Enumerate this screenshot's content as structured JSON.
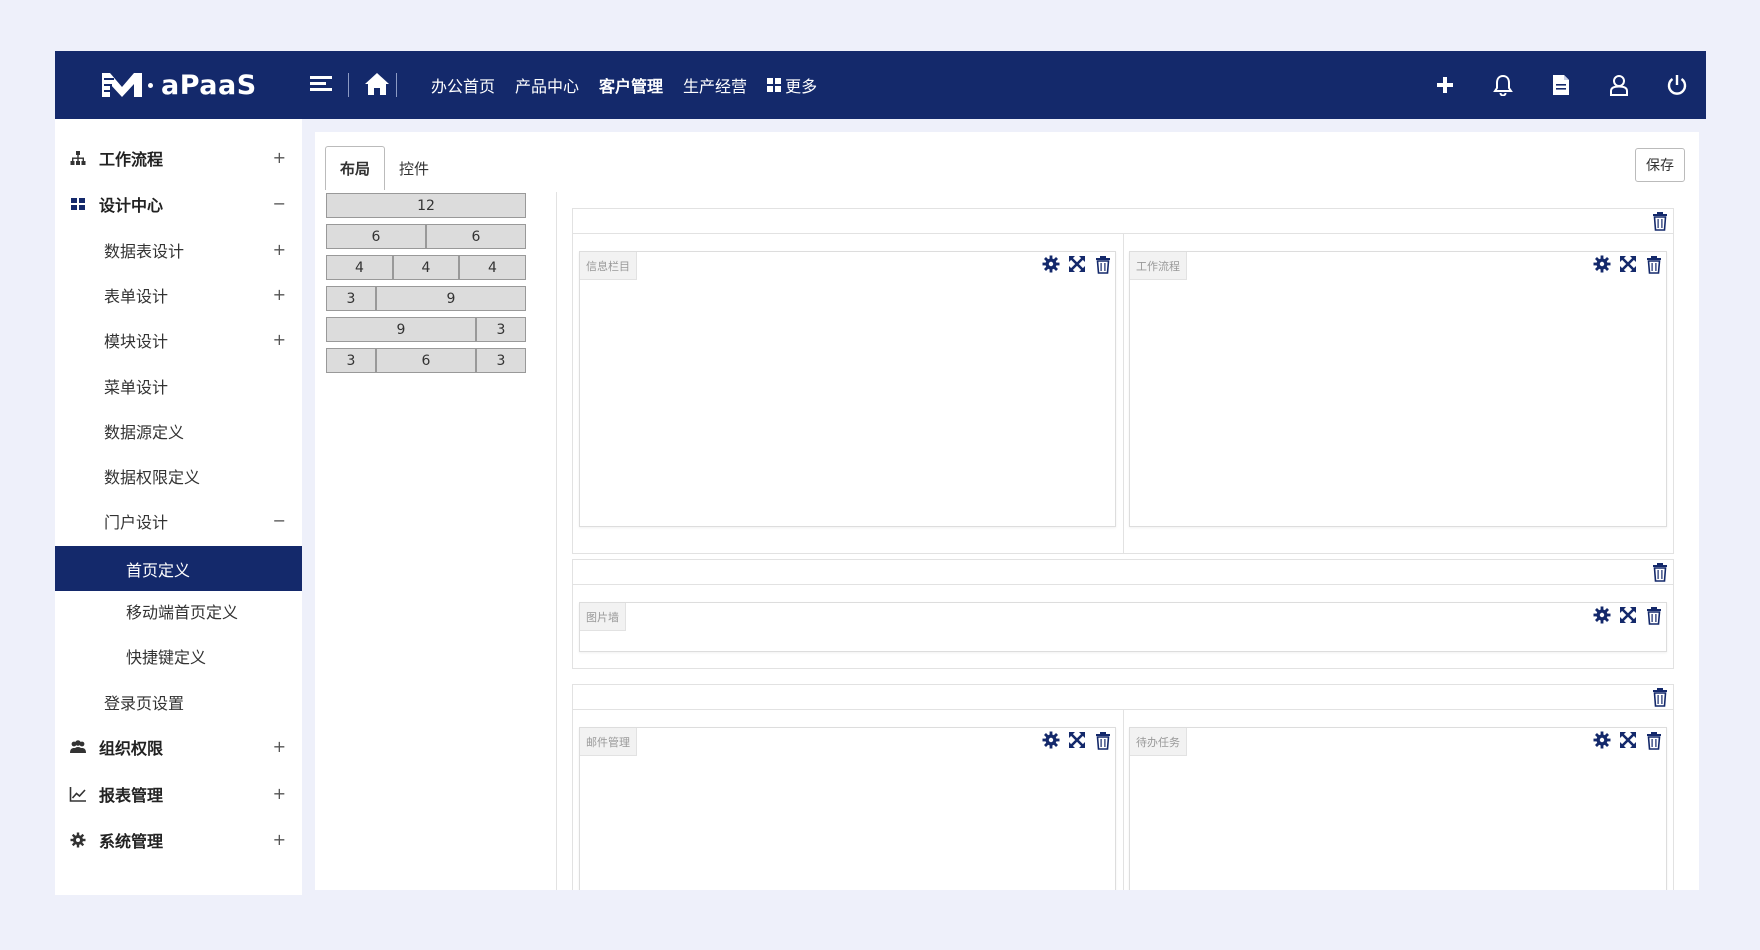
{
  "app": {
    "logo_text": "aPaaS"
  },
  "topnav": {
    "items": [
      "办公首页",
      "产品中心",
      "客户管理",
      "生产经营"
    ],
    "active_index": 2,
    "more_label": "更多"
  },
  "sidebar": {
    "items": [
      {
        "label": "工作流程",
        "toggle": "+",
        "icon": "sitemap-icon"
      },
      {
        "label": "设计中心",
        "toggle": "−",
        "icon": "grid-icon"
      },
      {
        "label": "数据表设计",
        "toggle": "+"
      },
      {
        "label": "表单设计",
        "toggle": "+"
      },
      {
        "label": "模块设计",
        "toggle": "+"
      },
      {
        "label": "菜单设计"
      },
      {
        "label": "数据源定义"
      },
      {
        "label": "数据权限定义"
      },
      {
        "label": "门户设计",
        "toggle": "−"
      },
      {
        "label": "首页定义"
      },
      {
        "label": "移动端首页定义"
      },
      {
        "label": "快捷键定义"
      },
      {
        "label": "登录页设置"
      },
      {
        "label": "组织权限",
        "toggle": "+",
        "icon": "users-icon"
      },
      {
        "label": "报表管理",
        "toggle": "+",
        "icon": "line-chart-icon"
      },
      {
        "label": "系统管理",
        "toggle": "+",
        "icon": "gear-icon"
      }
    ],
    "active_item": "首页定义"
  },
  "main": {
    "tabs": [
      "布局",
      "控件"
    ],
    "active_tab": 0,
    "save_label": "保存",
    "layout_palette": [
      [
        "12"
      ],
      [
        "6",
        "6"
      ],
      [
        "4",
        "4",
        "4"
      ],
      [
        "3",
        "9"
      ],
      [
        "9",
        "3"
      ],
      [
        "3",
        "6",
        "3"
      ]
    ],
    "widgets": {
      "info_column": "信息栏目",
      "workflow": "工作流程",
      "picture_wall": "图片墙",
      "mail": "邮件管理",
      "todo": "待办任务"
    }
  },
  "colors": {
    "brand": "#14296b",
    "page_bg": "#eef0fa",
    "active_sidebar": "#14296b"
  }
}
